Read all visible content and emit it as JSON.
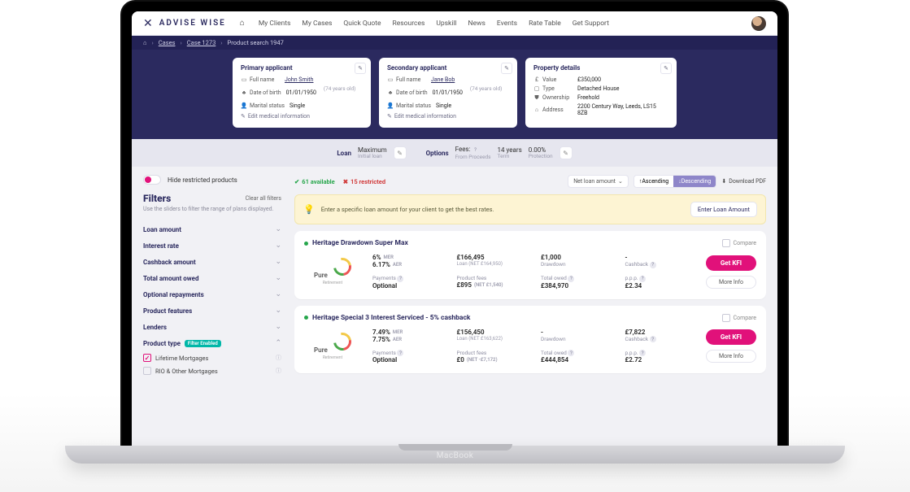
{
  "brand": {
    "name": "ADVISE WISE"
  },
  "nav": {
    "items": [
      "My Clients",
      "My Cases",
      "Quick Quote",
      "Resources",
      "Upskill",
      "News",
      "Events",
      "Rate Table",
      "Get Support"
    ]
  },
  "breadcrumb": {
    "items": [
      "Cases",
      "Case 1273",
      "Product search 1947"
    ]
  },
  "primary": {
    "title": "Primary applicant",
    "fullname_label": "Full name",
    "fullname": "John Smith",
    "dob_label": "Date of birth",
    "dob": "01/01/1950",
    "dob_hint": "(74 years old)",
    "marital_label": "Marital status",
    "marital": "Single",
    "edit_med": "Edit medical information"
  },
  "secondary": {
    "title": "Secondary applicant",
    "fullname_label": "Full name",
    "fullname": "Jane Bob",
    "dob_label": "Date of birth",
    "dob": "01/01/1950",
    "dob_hint": "(74 years old)",
    "marital_label": "Marital status",
    "marital": "Single",
    "edit_med": "Edit medical information"
  },
  "property": {
    "title": "Property details",
    "value_label": "Value",
    "value": "£350,000",
    "type_label": "Type",
    "type": "Detached House",
    "ownership_label": "Ownership",
    "ownership": "Freehold",
    "address_label": "Address",
    "address": "2200 Century Way, Leeds, LS15 8ZB"
  },
  "strip": {
    "loan_title": "Loan",
    "loan_top": "Maximum",
    "loan_bot": "Initial loan",
    "options_title": "Options",
    "fees_top": "Fees:",
    "fees_bot": "From Proceeds",
    "term_top": "14 years",
    "term_bot": "Term",
    "prot_top": "0.00%",
    "prot_bot": "Protection"
  },
  "availability": {
    "ok_count": "61 available",
    "bad_count": "15 restricted"
  },
  "sort": {
    "field": "Net loan amount",
    "asc": "Ascending",
    "desc": "Descending",
    "download": "Download PDF"
  },
  "notice": {
    "msg": "Enter a specific loan amount for your client to get the best rates.",
    "cta": "Enter Loan Amount"
  },
  "side": {
    "toggle": "Hide restricted products",
    "filters_title": "Filters",
    "clear": "Clear all filters",
    "hint": "Use the sliders to filter the range of plans displayed.",
    "items": [
      "Loan amount",
      "Interest rate",
      "Cashback amount",
      "Total amount owed",
      "Optional repayments",
      "Product features",
      "Lenders",
      "Product type"
    ],
    "filter_enabled": "Filter Enabled",
    "opt_lifetime": "Lifetime Mortgages",
    "opt_rio": "RIO & Other Mortgages"
  },
  "products": [
    {
      "name": "Heritage Drawdown Super Max",
      "compare": "Compare",
      "lender": "Pure",
      "lender_sub": "Retirement",
      "mer": "6%",
      "mer_unit": "MER",
      "aer": "6.17%",
      "aer_unit": "AER",
      "loan": "£166,495",
      "loan_net": "Loan (NET £164,950)",
      "drawdown": "£1,000",
      "drawdown_lbl": "Drawdown",
      "cashback": "-",
      "cashback_lbl": "Cashback",
      "payments_lbl": "Payments",
      "payments": "Optional",
      "fees_lbl": "Product fees",
      "fees": "£895",
      "fees_net": "(NET £1,540)",
      "owed_lbl": "Total owed",
      "owed": "£384,970",
      "ppp_lbl": "p.p.p.",
      "ppp": "£2.34",
      "cta": "Get KFI",
      "more": "More Info"
    },
    {
      "name": "Heritage Special 3 Interest Serviced - 5% cashback",
      "compare": "Compare",
      "lender": "Pure",
      "lender_sub": "Retirement",
      "mer": "7.49%",
      "mer_unit": "MER",
      "aer": "7.75%",
      "aer_unit": "AER",
      "loan": "£156,450",
      "loan_net": "Loan (NET £163,622)",
      "drawdown": "-",
      "drawdown_lbl": "Drawdown",
      "cashback": "£7,822",
      "cashback_lbl": "Cashback",
      "payments_lbl": "Payments",
      "payments": "Optional",
      "fees_lbl": "Product fees",
      "fees": "£0",
      "fees_net": "(NET -£7,172)",
      "owed_lbl": "Total owed",
      "owed": "£444,854",
      "ppp_lbl": "p.p.p.",
      "ppp": "£2.72",
      "cta": "Get KFI",
      "more": "More Info"
    }
  ]
}
